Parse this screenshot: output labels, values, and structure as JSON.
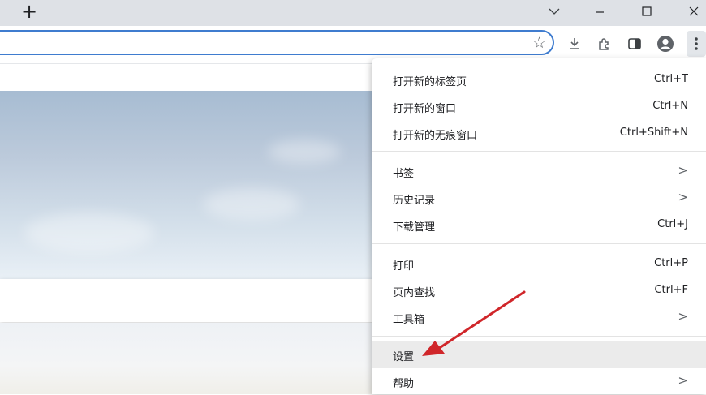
{
  "tabbar": {
    "new_tab_glyph": "+"
  },
  "window_controls": {
    "dropdown": "∨",
    "minimize": "–",
    "maximize": "☐",
    "close": "✕"
  },
  "toolbar": {
    "bookmark_star": "☆"
  },
  "menu": {
    "items": [
      {
        "label": "打开新的标签页",
        "shortcut": "Ctrl+T"
      },
      {
        "label": "打开新的窗口",
        "shortcut": "Ctrl+N"
      },
      {
        "label": "打开新的无痕窗口",
        "shortcut": "Ctrl+Shift+N"
      },
      {
        "label": "书签",
        "shortcut": "",
        "submenu": ">"
      },
      {
        "label": "历史记录",
        "shortcut": "",
        "submenu": ">"
      },
      {
        "label": "下载管理",
        "shortcut": "Ctrl+J"
      },
      {
        "label": "打印",
        "shortcut": "Ctrl+P"
      },
      {
        "label": "页内查找",
        "shortcut": "Ctrl+F"
      },
      {
        "label": "工具箱",
        "shortcut": "",
        "submenu": ">"
      },
      {
        "label": "设置",
        "shortcut": ""
      },
      {
        "label": "帮助",
        "shortcut": "",
        "submenu": ">"
      }
    ]
  },
  "colors": {
    "accent": "#3f7ccf",
    "highlight": "#ebebeb",
    "annotation_arrow": "#d0262a"
  }
}
